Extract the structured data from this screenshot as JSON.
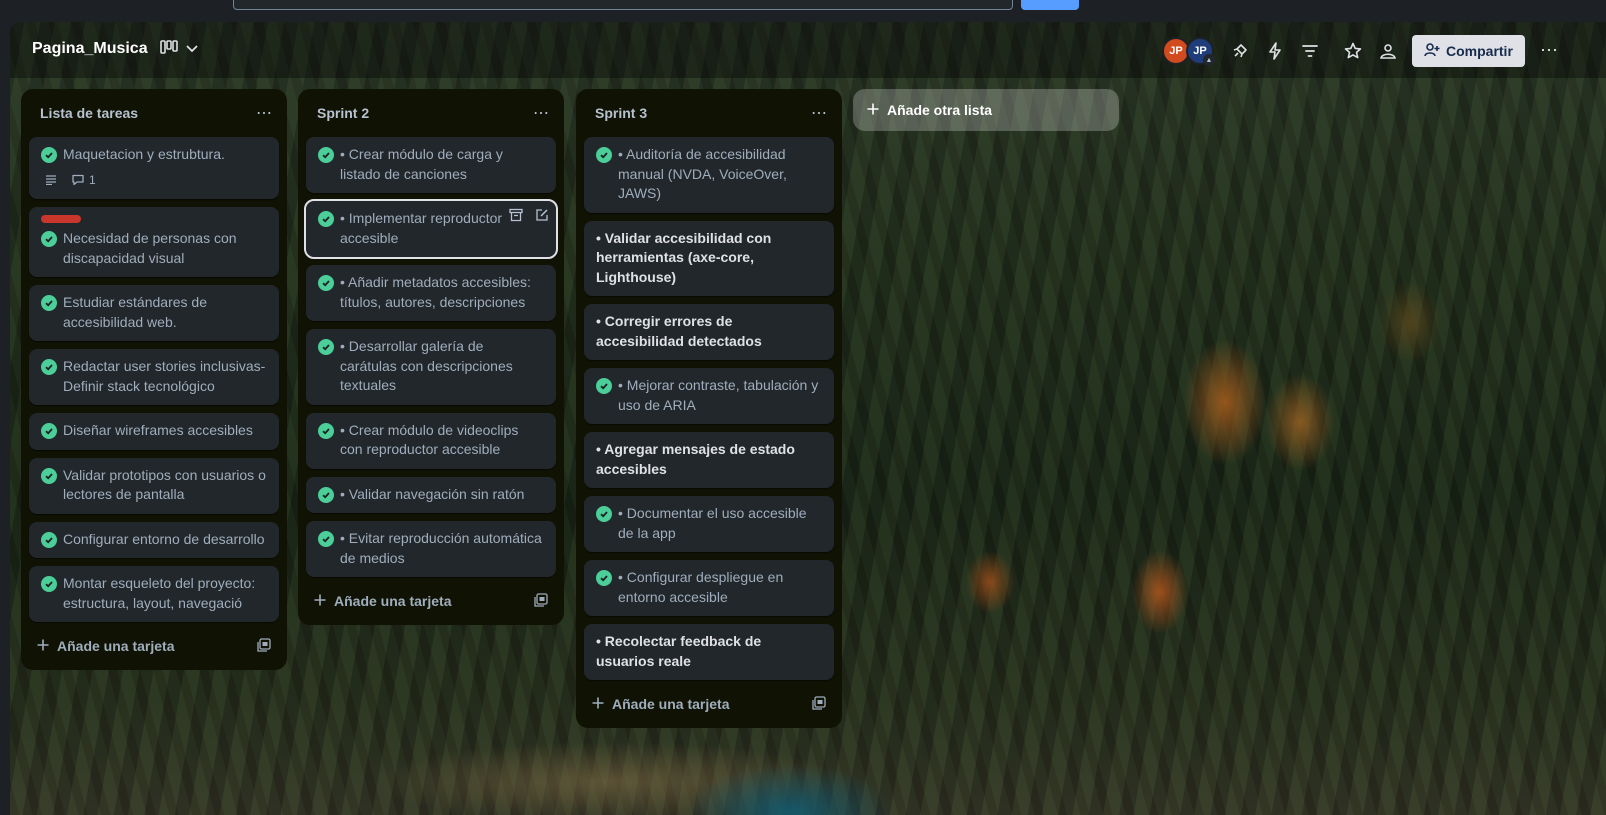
{
  "board": {
    "title": "Pagina_Musica",
    "share_label": "Compartir",
    "add_list_label": "Añade otra lista",
    "avatars": [
      {
        "initials": "JP"
      },
      {
        "initials": "JP"
      }
    ]
  },
  "lists": [
    {
      "title": "Lista de tareas",
      "add_card_label": "Añade una tarjeta",
      "cards": [
        {
          "text": "Maquetacion y estrubtura.",
          "done": true,
          "comments": "1"
        },
        {
          "text": "Necesidad de personas con discapacidad visual",
          "done": true,
          "label_color": "#c9372c"
        },
        {
          "text": "Estudiar estándares de accesibilidad web.",
          "done": true
        },
        {
          "text": "Redactar user stories inclusivas- Definir stack tecnológico",
          "done": true
        },
        {
          "text": "Diseñar wireframes accesibles",
          "done": true
        },
        {
          "text": "Validar prototipos con usuarios o lectores de pantalla",
          "done": true
        },
        {
          "text": "Configurar entorno de desarrollo",
          "done": true
        },
        {
          "text": "Montar esqueleto del proyecto: estructura, layout, navegació",
          "done": true
        }
      ]
    },
    {
      "title": "Sprint 2",
      "add_card_label": "Añade una tarjeta",
      "cards": [
        {
          "text": "• Crear módulo de carga y listado de canciones",
          "done": true
        },
        {
          "text": "• Implementar reproductor audio accesible",
          "done": true
        },
        {
          "text": "• Añadir metadatos accesibles: títulos, autores, descripciones",
          "done": true
        },
        {
          "text": "• Desarrollar galería de carátulas con descripciones textuales",
          "done": true
        },
        {
          "text": "• Crear módulo de videoclips con reproductor accesible",
          "done": true
        },
        {
          "text": "• Validar navegación sin ratón",
          "done": true
        },
        {
          "text": "• Evitar reproducción automática de medios",
          "done": true
        }
      ]
    },
    {
      "title": "Sprint 3",
      "add_card_label": "Añade una tarjeta",
      "cards": [
        {
          "text": "• Auditoría de accesibilidad manual (NVDA, VoiceOver, JAWS)",
          "done": true
        },
        {
          "text": "• Validar accesibilidad con herramientas (axe-core, Lighthouse)",
          "done": false
        },
        {
          "text": "• Corregir errores de accesibilidad detectados",
          "done": false
        },
        {
          "text": "• Mejorar contraste, tabulación y uso de ARIA",
          "done": true
        },
        {
          "text": "• Agregar mensajes de estado accesibles",
          "done": false
        },
        {
          "text": "• Documentar el uso accesible de la app",
          "done": true
        },
        {
          "text": "• Configurar despliegue en entorno accesible",
          "done": true
        },
        {
          "text": "• Recolectar feedback de usuarios reale",
          "done": false
        }
      ]
    }
  ]
}
